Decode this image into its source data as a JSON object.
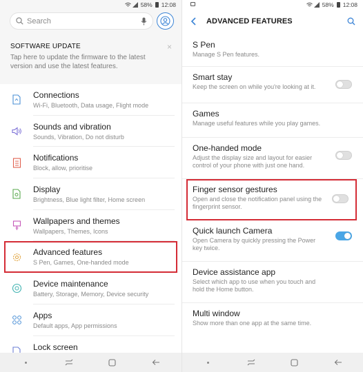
{
  "left": {
    "status": {
      "battery": "58%",
      "time": "12:08"
    },
    "search": {
      "placeholder": "Search"
    },
    "update": {
      "title": "SOFTWARE UPDATE",
      "desc": "Tap here to update the firmware to the latest version and use the latest features.",
      "close": "×"
    },
    "items": [
      {
        "title": "Connections",
        "sub": "Wi-Fi, Bluetooth, Data usage, Flight mode",
        "icon": "connections-icon"
      },
      {
        "title": "Sounds and vibration",
        "sub": "Sounds, Vibration, Do not disturb",
        "icon": "sound-icon"
      },
      {
        "title": "Notifications",
        "sub": "Block, allow, prioritise",
        "icon": "notifications-icon"
      },
      {
        "title": "Display",
        "sub": "Brightness, Blue light filter, Home screen",
        "icon": "display-icon"
      },
      {
        "title": "Wallpapers and themes",
        "sub": "Wallpapers, Themes, Icons",
        "icon": "wallpaper-icon"
      },
      {
        "title": "Advanced features",
        "sub": "S Pen, Games, One-handed mode",
        "icon": "advanced-features-icon"
      },
      {
        "title": "Device maintenance",
        "sub": "Battery, Storage, Memory, Device security",
        "icon": "device-maintenance-icon"
      },
      {
        "title": "Apps",
        "sub": "Default apps, App permissions",
        "icon": "apps-icon"
      },
      {
        "title": "Lock screen",
        "sub": "",
        "icon": "lock-screen-icon"
      }
    ]
  },
  "right": {
    "status": {
      "battery": "58%",
      "time": "12:08"
    },
    "header": {
      "title": "ADVANCED FEATURES"
    },
    "items": [
      {
        "title": "S Pen",
        "sub": "Manage S Pen features.",
        "toggle": null
      },
      {
        "title": "Smart stay",
        "sub": "Keep the screen on while you're looking at it.",
        "toggle": "off"
      },
      {
        "title": "Games",
        "sub": "Manage useful features while you play games.",
        "toggle": null
      },
      {
        "title": "One-handed mode",
        "sub": "Adjust the display size and layout for easier control of your phone with just one hand.",
        "toggle": "off"
      },
      {
        "title": "Finger sensor gestures",
        "sub": "Open and close the notification panel using the fingerprint sensor.",
        "toggle": "off"
      },
      {
        "title": "Quick launch Camera",
        "sub": "Open Camera by quickly pressing the Power key twice.",
        "toggle": "on"
      },
      {
        "title": "Device assistance app",
        "sub": "Select which app to use when you touch and hold the Home button.",
        "toggle": null
      },
      {
        "title": "Multi window",
        "sub": "Show more than one app at the same time.",
        "toggle": null
      }
    ]
  },
  "colors": {
    "accent": "#3b84d6",
    "highlight": "#d42b35",
    "toggle_on": "#4aa6e6"
  }
}
